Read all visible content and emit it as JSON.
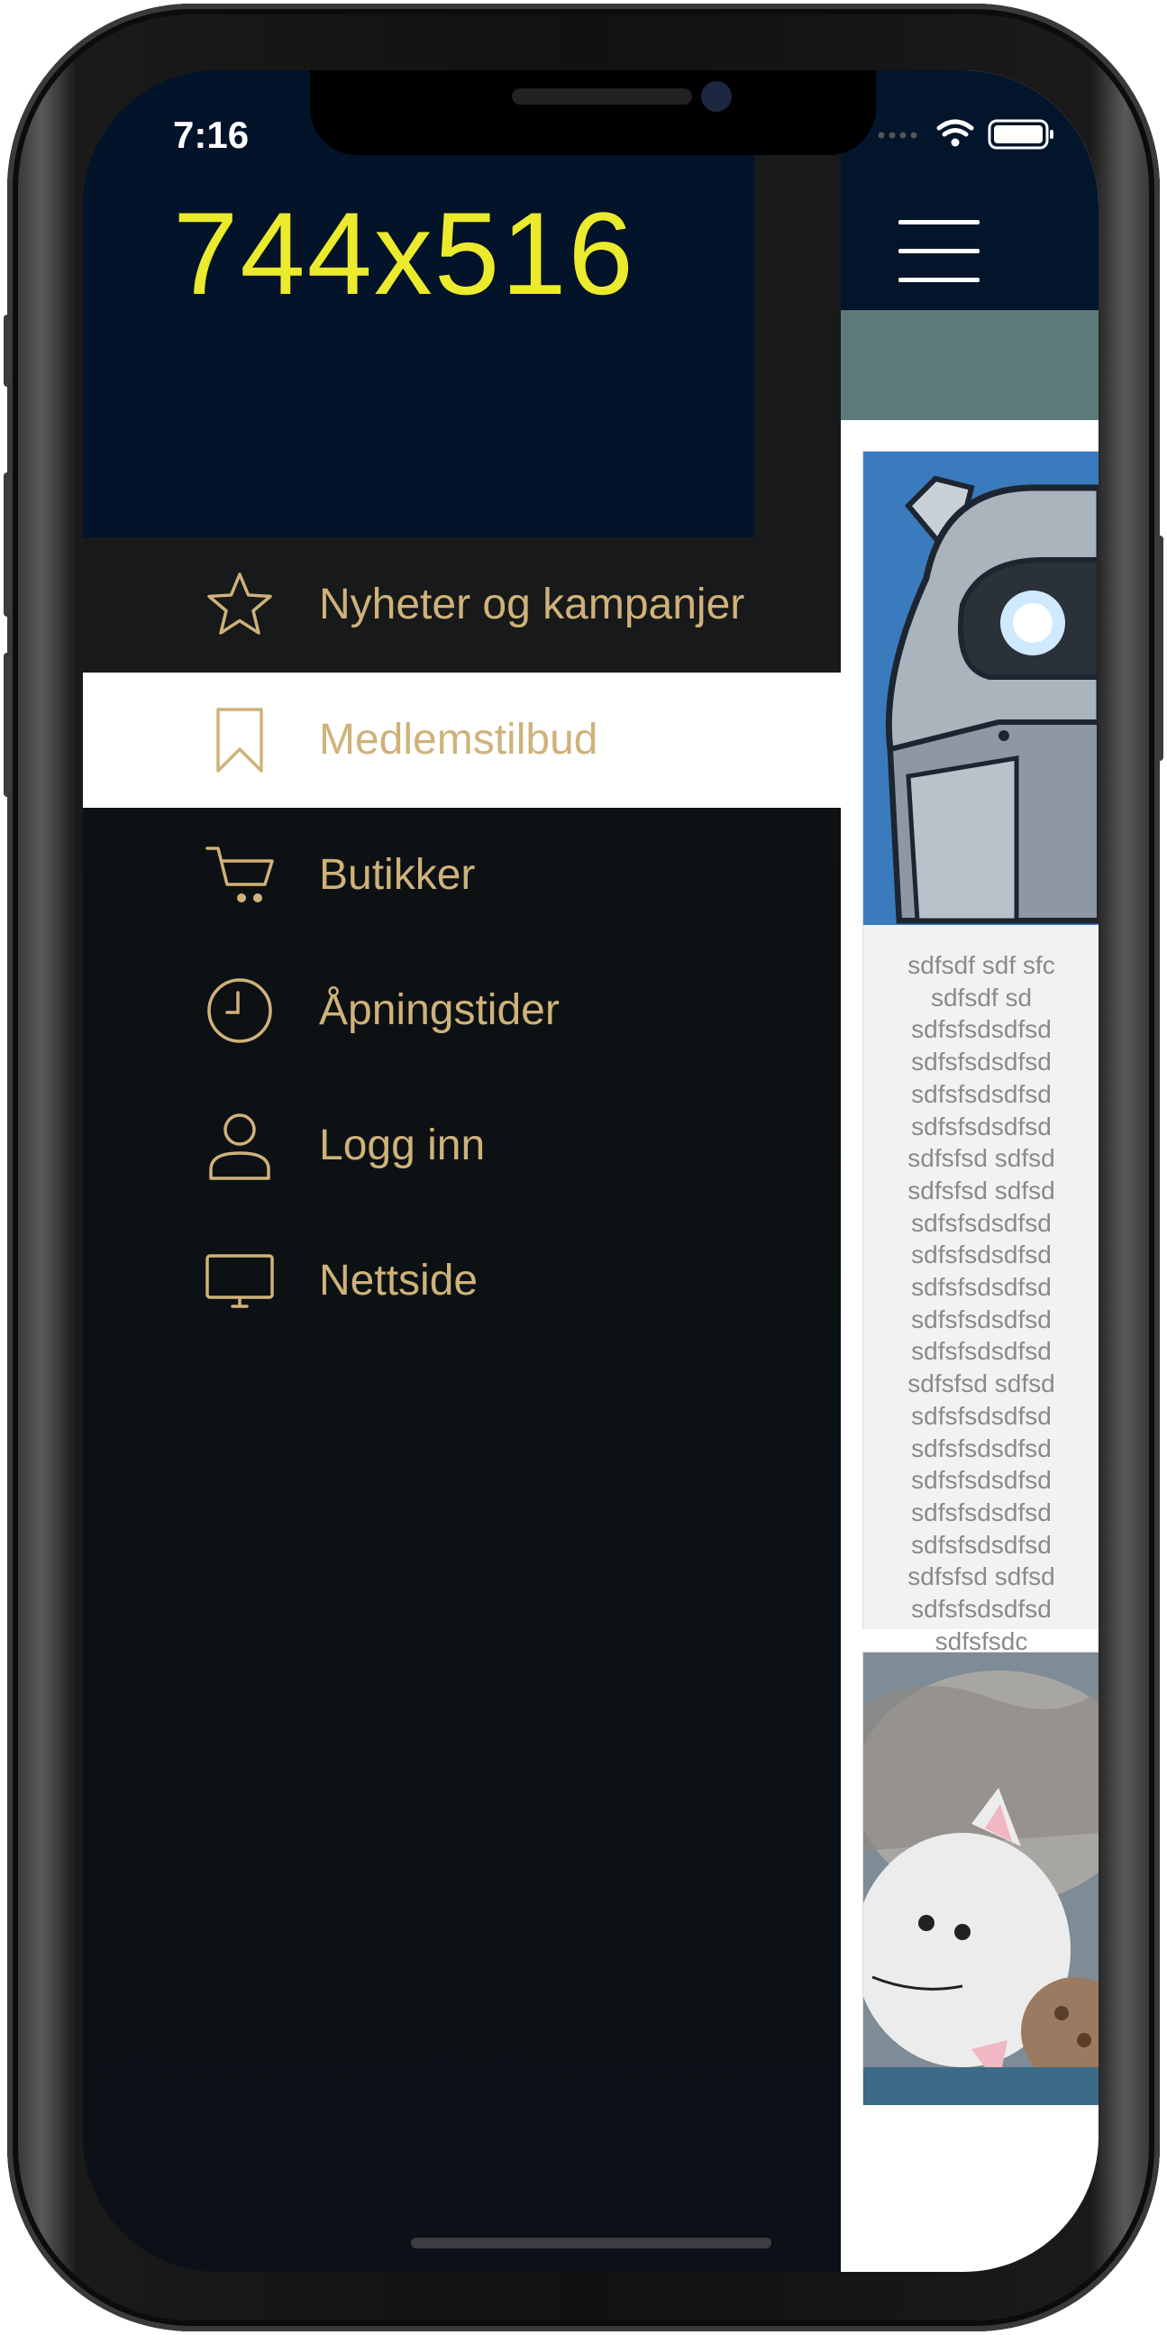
{
  "status_bar": {
    "time": "7:16"
  },
  "drawer": {
    "header_text": "744x516",
    "items": [
      {
        "label": "Nyheter og kampanjer",
        "icon": "star-icon",
        "active": false
      },
      {
        "label": "Medlemstilbud",
        "icon": "bookmark-icon",
        "active": true
      },
      {
        "label": "Butikker",
        "icon": "cart-icon",
        "active": false
      },
      {
        "label": "Åpningstider",
        "icon": "clock-icon",
        "active": false
      },
      {
        "label": "Logg inn",
        "icon": "user-icon",
        "active": false
      },
      {
        "label": "Nettside",
        "icon": "monitor-icon",
        "active": false
      }
    ]
  },
  "content": {
    "card1_lines": [
      "sdfsdf sdf sfc",
      "sdfsdf sd",
      "sdfsfsdsdfsd",
      "sdfsfsdsdfsd",
      "sdfsfsdsdfsd",
      "sdfsfsdsdfsd",
      "sdfsfsd sdfsd",
      "sdfsfsd sdfsd",
      "sdfsfsdsdfsd",
      "sdfsfsdsdfsd",
      "sdfsfsdsdfsd",
      "sdfsfsdsdfsd",
      "sdfsfsdsdfsd",
      "sdfsfsd sdfsd",
      "sdfsfsdsdfsd",
      "sdfsfsdsdfsd",
      "sdfsfsdsdfsd",
      "sdfsfsdsdfsd",
      "sdfsfsdsdfsd",
      "sdfsfsd sdfsd",
      "sdfsfsdsdfsd",
      "sdfsfsdc"
    ]
  },
  "colors": {
    "drawer_text": "#cfb27a",
    "header_text": "#ecea2c",
    "header_bg": "#02132a"
  }
}
